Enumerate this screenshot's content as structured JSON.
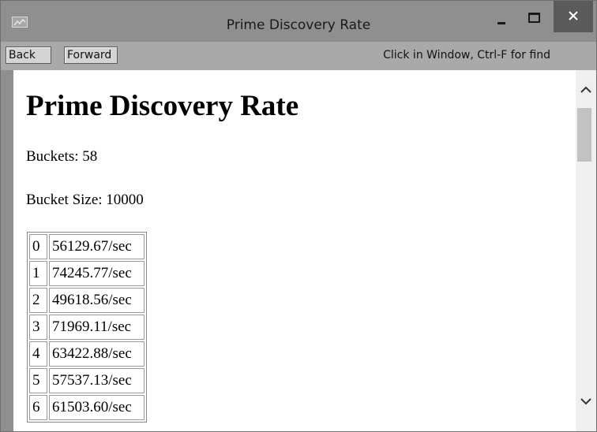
{
  "window": {
    "title": "Prime Discovery Rate",
    "icon": "chart-app-icon",
    "controls": {
      "minimize": "minimize-icon",
      "maximize": "maximize-icon",
      "close": "close-icon"
    },
    "close_color": "#5a5a5a"
  },
  "toolbar": {
    "back_label": "Back",
    "forward_label": "Forward",
    "hint": "Click in Window, Ctrl-F for find"
  },
  "page": {
    "title": "Prime Discovery Rate",
    "buckets": "Buckets: 58",
    "bucket_size": "Bucket Size: 10000",
    "rates": [
      {
        "index": "0",
        "rate": "56129.67/sec"
      },
      {
        "index": "1",
        "rate": "74245.77/sec"
      },
      {
        "index": "2",
        "rate": "49618.56/sec"
      },
      {
        "index": "3",
        "rate": "71969.11/sec"
      },
      {
        "index": "4",
        "rate": "63422.88/sec"
      },
      {
        "index": "5",
        "rate": "57537.13/sec"
      },
      {
        "index": "6",
        "rate": "61503.60/sec"
      }
    ]
  },
  "scrollbar": {
    "up_icon": "chevron-up-icon",
    "down_icon": "chevron-down-icon"
  }
}
